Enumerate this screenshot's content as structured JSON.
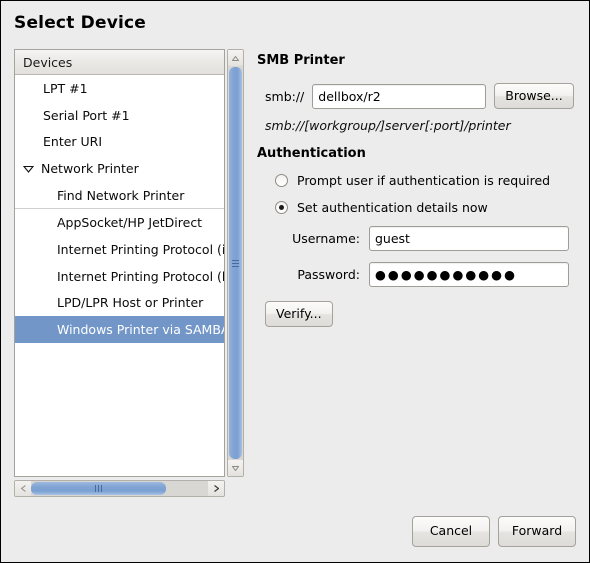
{
  "dialog": {
    "title": "Select Device"
  },
  "device_list": {
    "header": "Devices",
    "items": [
      {
        "label": "LPT #1",
        "indent": 1,
        "selected": false,
        "expander": "",
        "separator_after": false
      },
      {
        "label": "Serial Port #1",
        "indent": 1,
        "selected": false,
        "expander": "",
        "separator_after": false
      },
      {
        "label": "Enter URI",
        "indent": 1,
        "selected": false,
        "expander": "",
        "separator_after": false
      },
      {
        "label": "Network Printer",
        "indent": 0,
        "selected": false,
        "expander": "triangle-down-icon",
        "separator_after": false
      },
      {
        "label": "Find Network Printer",
        "indent": 2,
        "selected": false,
        "expander": "",
        "separator_after": true
      },
      {
        "label": "AppSocket/HP JetDirect",
        "indent": 2,
        "selected": false,
        "expander": "",
        "separator_after": false
      },
      {
        "label": "Internet Printing Protocol (ipp)",
        "indent": 2,
        "selected": false,
        "expander": "",
        "separator_after": false
      },
      {
        "label": "Internet Printing Protocol (https)",
        "indent": 2,
        "selected": false,
        "expander": "",
        "separator_after": false
      },
      {
        "label": "LPD/LPR Host or Printer",
        "indent": 2,
        "selected": false,
        "expander": "",
        "separator_after": false
      },
      {
        "label": "Windows Printer via SAMBA",
        "indent": 2,
        "selected": true,
        "expander": "",
        "separator_after": false
      }
    ],
    "selection_color": "#7296c8"
  },
  "scrollbars": {
    "vertical": {
      "up_arrow": "▲",
      "down_arrow": "▼",
      "thumb_color": "#7ba0d2"
    },
    "horizontal": {
      "left_arrow": "❮",
      "right_arrow": "❯",
      "thumb_color": "#7ba0d2"
    }
  },
  "panel": {
    "section_title": "SMB Printer",
    "uri_prefix": "smb://",
    "uri_value": "dellbox/r2",
    "uri_placeholder": "",
    "browse_label": "Browse...",
    "uri_hint": "smb://[workgroup/]server[:port]/printer",
    "auth_title": "Authentication",
    "radio_prompt_label": "Prompt user if authentication is required",
    "radio_prompt_selected": false,
    "radio_set_label": "Set authentication details now",
    "radio_set_selected": true,
    "username_label": "Username:",
    "username_value": "guest",
    "password_label": "Password:",
    "password_value": "●●●●●●●●●●●",
    "verify_label": "Verify..."
  },
  "footer": {
    "cancel_label": "Cancel",
    "forward_label": "Forward"
  }
}
